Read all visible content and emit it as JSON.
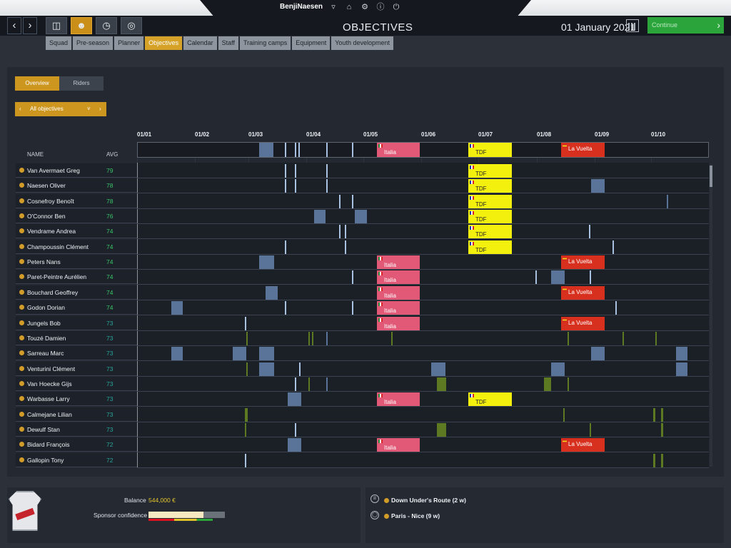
{
  "titlebar": {
    "title": "BenjiNaesen"
  },
  "nav": {
    "page_title": "OBJECTIVES",
    "date": "01 January 2021",
    "continue_label": "Continue",
    "tabs": [
      "Squad",
      "Pre-season",
      "Planner",
      "Objectives",
      "Calendar",
      "Staff",
      "Training camps",
      "Equipment",
      "Youth development"
    ],
    "active_tab": "Objectives"
  },
  "view_toggle": {
    "overview": "Overview",
    "riders": "Riders"
  },
  "filter": {
    "label": "All objectives"
  },
  "months": [
    "01/01",
    "01/02",
    "01/03",
    "01/04",
    "01/05",
    "01/06",
    "01/07",
    "01/08",
    "01/09",
    "01/10"
  ],
  "columns": {
    "name": "NAME",
    "avg": "AVG"
  },
  "colors": {
    "accent": "#cd961f",
    "avg_high": "#3bc467",
    "avg_low": "#28a59c",
    "italia": "#e25877",
    "tdf": "#f4f00e",
    "vuelta": "#d8301f"
  },
  "riders": [
    {
      "name": "Van Avermaet Greg",
      "avg": "79"
    },
    {
      "name": "Naesen Oliver",
      "avg": "78"
    },
    {
      "name": "Cosnefroy Benoît",
      "avg": "78"
    },
    {
      "name": "O'Connor Ben",
      "avg": "76"
    },
    {
      "name": "Vendrame Andrea",
      "avg": "74"
    },
    {
      "name": "Champoussin Clément",
      "avg": "74"
    },
    {
      "name": "Peters Nans",
      "avg": "74"
    },
    {
      "name": "Paret-Peintre Aurélien",
      "avg": "74"
    },
    {
      "name": "Bouchard Geoffrey",
      "avg": "74"
    },
    {
      "name": "Godon Dorian",
      "avg": "74"
    },
    {
      "name": "Jungels Bob",
      "avg": "73"
    },
    {
      "name": "Touzé Damien",
      "avg": "73"
    },
    {
      "name": "Sarreau Marc",
      "avg": "73"
    },
    {
      "name": "Venturini Clément",
      "avg": "73"
    },
    {
      "name": "Van Hoecke Gijs",
      "avg": "73"
    },
    {
      "name": "Warbasse Larry",
      "avg": "73"
    },
    {
      "name": "Calmejane Lilian",
      "avg": "73"
    },
    {
      "name": "Dewulf Stan",
      "avg": "73"
    },
    {
      "name": "Bidard François",
      "avg": "72"
    },
    {
      "name": "Gallopin Tony",
      "avg": "72"
    }
  ],
  "races": {
    "italia": "Italia",
    "tdf": "TDF",
    "vuelta": "La Vuelta"
  },
  "footer": {
    "balance_label": "Balance",
    "balance_value": "544,000 €",
    "sponsor_label": "Sponsor confidence",
    "sponsor_confidence": 0.72,
    "next_races": [
      {
        "name": "Down Under's Route (2 w)"
      },
      {
        "name": "Paris - Nice (9 w)"
      }
    ]
  }
}
